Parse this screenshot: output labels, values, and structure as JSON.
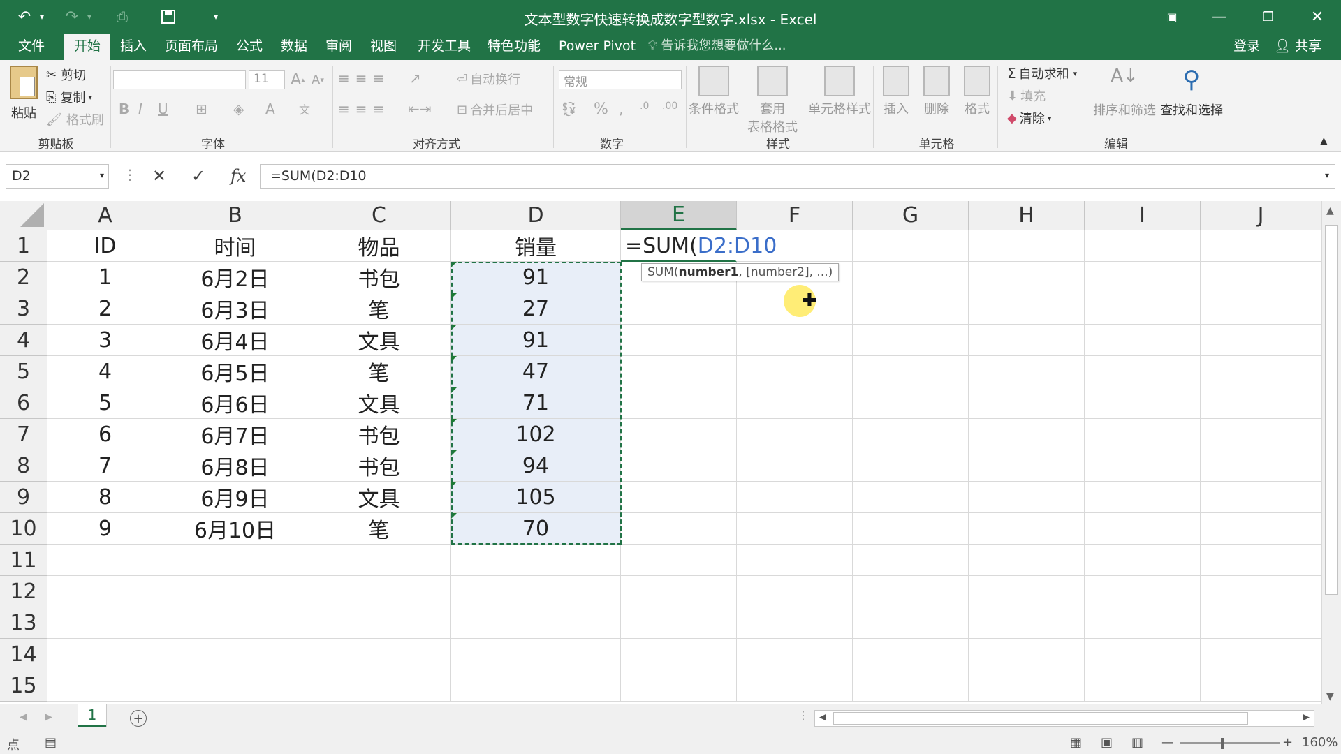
{
  "titlebar": {
    "title": "文本型数字快速转换成数字型数字.xlsx - Excel",
    "undo_icon": "undo-icon",
    "redo_icon": "redo-icon",
    "save_icon": "save-icon"
  },
  "tabs": [
    "文件",
    "开始",
    "插入",
    "页面布局",
    "公式",
    "数据",
    "审阅",
    "视图",
    "开发工具",
    "特色功能",
    "Power Pivot"
  ],
  "active_tab": "开始",
  "tell_me": "告诉我您想要做什么...",
  "login": "登录",
  "share": "共享",
  "ribbon": {
    "clipboard": {
      "paste": "粘贴",
      "cut": "剪切",
      "copy": "复制",
      "format_painter": "格式刷",
      "label": "剪贴板"
    },
    "font": {
      "size": "11",
      "bold": "B",
      "italic": "I",
      "underline": "U",
      "label": "字体"
    },
    "alignment": {
      "wrap": "自动换行",
      "merge": "合并后居中",
      "label": "对齐方式"
    },
    "number": {
      "format": "常规",
      "percent": "%",
      "comma": ",",
      "inc_decimal": ".0\n.00",
      "dec_decimal": ".00\n.0",
      "label": "数字"
    },
    "styles": {
      "conditional": "条件格式",
      "table_format_1": "套用",
      "table_format_2": "表格格式",
      "cell_styles": "单元格样式",
      "label": "样式"
    },
    "cells": {
      "insert": "插入",
      "delete": "删除",
      "format": "格式",
      "label": "单元格"
    },
    "editing": {
      "autosum": "自动求和",
      "fill": "填充",
      "clear": "清除",
      "sort_filter": "排序和筛选",
      "find_select": "查找和选择",
      "label": "编辑"
    }
  },
  "formula_bar": {
    "name_box": "D2",
    "formula": "=SUM(D2:D10"
  },
  "columns": [
    "A",
    "B",
    "C",
    "D",
    "E",
    "F",
    "G",
    "H",
    "I",
    "J"
  ],
  "selected_column": "E",
  "rows": [
    "1",
    "2",
    "3",
    "4",
    "5",
    "6",
    "7",
    "8",
    "9",
    "10",
    "11",
    "12",
    "13",
    "14",
    "15"
  ],
  "header_row": [
    "ID",
    "时间",
    "物品",
    "销量"
  ],
  "data_rows": [
    [
      "1",
      "6月2日",
      "书包",
      "91"
    ],
    [
      "2",
      "6月3日",
      "笔",
      "27"
    ],
    [
      "3",
      "6月4日",
      "文具",
      "91"
    ],
    [
      "4",
      "6月5日",
      "笔",
      "47"
    ],
    [
      "5",
      "6月6日",
      "文具",
      "71"
    ],
    [
      "6",
      "6月7日",
      "书包",
      "102"
    ],
    [
      "7",
      "6月8日",
      "书包",
      "94"
    ],
    [
      "8",
      "6月9日",
      "文具",
      "105"
    ],
    [
      "9",
      "6月10日",
      "笔",
      "70"
    ]
  ],
  "edit_cell": {
    "prefix": "=SUM(",
    "ref": "D2:D10"
  },
  "tooltip": {
    "fn": "SUM(",
    "arg1": "number1",
    "rest": ", [number2], ...)"
  },
  "sheet_tab": "1",
  "zoom": "160%",
  "colors": {
    "excel_green": "#217346",
    "ref_blue": "#3b6ec9",
    "selection_fill": "#e8eef8"
  }
}
